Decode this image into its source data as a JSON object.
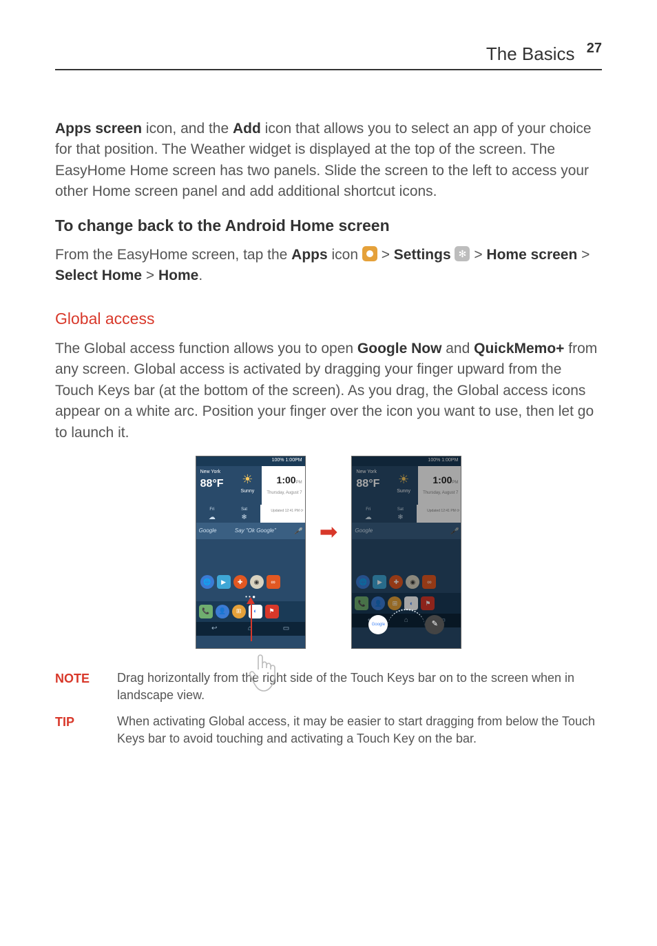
{
  "header": {
    "section": "The Basics",
    "page": "27"
  },
  "p1": {
    "lead_bold1": "Apps screen",
    "seg1": " icon, and the ",
    "lead_bold2": "Add",
    "seg2": " icon that allows you to select an app of your choice for that position. The Weather widget is displayed at the top of the screen. The EasyHome Home screen has two panels. Slide the screen to the left to access your other Home screen panel and add additional shortcut icons."
  },
  "sub1": "To change back to the Android Home screen",
  "p2": {
    "seg1": "From the EasyHome screen, tap the ",
    "b1": "Apps",
    "seg2": " icon ",
    "gt1": " > ",
    "b2": "Settings",
    "gt2": " > ",
    "b3": "Home screen",
    "gt3": " > ",
    "b4": "Select Home",
    "gt4": " > ",
    "b5": "Home",
    "end": "."
  },
  "h2": "Global access",
  "p3": {
    "seg1": "The Global access function allows you to open ",
    "b1": "Google Now",
    "seg2": " and ",
    "b2": "QuickMemo+",
    "seg3": " from any screen. Global access is activated by dragging your finger upward from the Touch Keys bar (at the bottom of the screen). As you drag, the Global access icons appear on a white arc. Position your finger over the icon you want to use, then let go to launch it."
  },
  "phone": {
    "status": "100% 1:00PM",
    "city": "New York",
    "temp": "88°F",
    "cond": "Sunny",
    "time": "1:00",
    "pm": "PM",
    "date": "Thursday, August 7",
    "fri": "Fri",
    "sat": "Sat",
    "updated": "Updated 12:41 PM ⟳",
    "google": "Google",
    "say": "Say \"Ok Google\"",
    "arc_google": "Google"
  },
  "note": {
    "label": "NOTE",
    "text": "Drag horizontally from the right side of the Touch Keys bar on to the screen when in landscape view."
  },
  "tip": {
    "label": "TIP",
    "text": "When activating Global access, it may be easier to start dragging from below the Touch Keys bar to avoid touching and activating a Touch Key on the bar."
  }
}
